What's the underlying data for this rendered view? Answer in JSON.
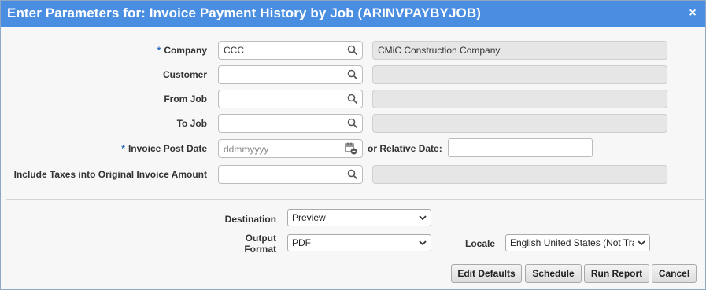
{
  "dialog": {
    "title": "Enter Parameters for: Invoice Payment History by Job (ARINVPAYBYJOB)",
    "close_glyph": "×"
  },
  "form": {
    "required_marker": "*",
    "company": {
      "label": "Company",
      "value": "CCC",
      "description": "CMiC Construction Company"
    },
    "customer": {
      "label": "Customer",
      "value": "",
      "description": ""
    },
    "from_job": {
      "label": "From Job",
      "value": "",
      "description": ""
    },
    "to_job": {
      "label": "To Job",
      "value": "",
      "description": ""
    },
    "invoice_post_date": {
      "label": "Invoice Post Date",
      "placeholder": "ddmmyyyy",
      "relative_label": "or Relative Date:",
      "relative_value": ""
    },
    "include_taxes": {
      "label": "Include Taxes into Original Invoice Amount",
      "value": "",
      "description": ""
    }
  },
  "output": {
    "destination_label": "Destination",
    "destination_value": "Preview",
    "format_label_line1": "Output",
    "format_label_line2": "Format",
    "format_value": "PDF",
    "locale_label": "Locale",
    "locale_value": "English United States (Not Tra"
  },
  "buttons": {
    "edit_defaults": "Edit Defaults",
    "schedule": "Schedule",
    "run_report": "Run Report",
    "cancel": "Cancel"
  },
  "icons": {
    "lookup": "search-icon",
    "calendar": "calendar-icon",
    "dropdown": "chevron-down-icon",
    "close": "close-icon"
  },
  "colors": {
    "titlebar": "#4a8ee1",
    "required": "#2d6bbf",
    "readonly_fill": "#e6e6e6"
  }
}
